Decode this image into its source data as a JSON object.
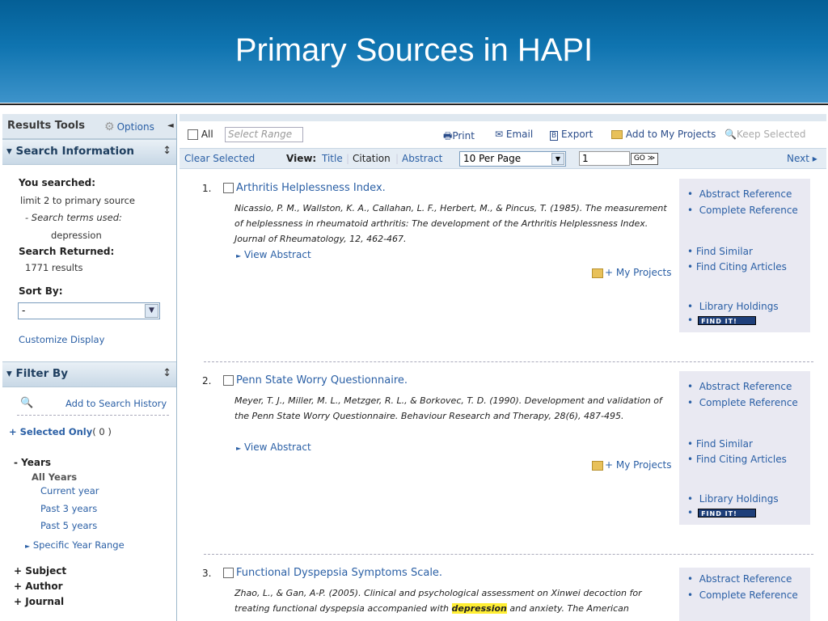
{
  "slide": {
    "title": "Primary Sources in HAPI"
  },
  "left": {
    "results_tools": "Results Tools",
    "options": "Options",
    "search_info_title": "Search Information",
    "you_searched_label": "You searched:",
    "you_searched_value": "limit 2 to primary source",
    "terms_label": "- Search terms used:",
    "terms_value": "depression",
    "returned_label": "Search Returned:",
    "returned_value": "1771 results",
    "sort_label": "Sort By:",
    "sort_value": "-",
    "customize": "Customize Display",
    "filter_title": "Filter By",
    "add_history": "Add to Search History",
    "selected_only": "Selected Only",
    "selected_count": "( 0 )",
    "years": "Years",
    "all_years": "All Years",
    "current_year": "Current year",
    "past3": "Past 3 years",
    "past5": "Past 5 years",
    "specific_range": "Specific Year Range",
    "subject": "Subject",
    "author": "Author",
    "journal": "Journal"
  },
  "toolbar": {
    "all": "All",
    "select_range_placeholder": "Select Range",
    "print": "Print",
    "email": "Email",
    "export": "Export",
    "add_projects": "Add to My Projects",
    "keep_selected": "Keep Selected",
    "clear_selected": "Clear Selected",
    "view_label": "View:",
    "view_title": "Title",
    "view_citation": "Citation",
    "view_abstract": "Abstract",
    "per_page": "10 Per Page",
    "page_value": "1",
    "go": "GO ≫",
    "next": "Next ▸"
  },
  "results": [
    {
      "num": "1.",
      "title": "Arthritis Helplessness Index.",
      "citation": "Nicassio, P. M., Wallston, K. A., Callahan, L. F., Herbert, M., & Pincus, T. (1985). The measurement of helplessness in rheumatoid arthritis: The development of the Arthritis Helplessness Index. Journal of Rheumatology, 12, 462-467.",
      "view_abstract": "View Abstract",
      "my_projects": "+ My Projects"
    },
    {
      "num": "2.",
      "title": "Penn State Worry Questionnaire.",
      "citation": "Meyer, T. J., Miller, M. L., Metzger, R. L., & Borkovec, T. D. (1990). Development and validation of the Penn State Worry Questionnaire. Behaviour Research and Therapy, 28(6), 487-495.",
      "view_abstract": "View Abstract",
      "my_projects": "+ My Projects"
    },
    {
      "num": "3.",
      "title": "Functional Dyspepsia Symptoms Scale.",
      "citation_pre": "Zhao, L., & Gan, A-P. (2005). Clinical and psychological assessment on Xinwei decoction for treating functional dyspepsia accompanied with ",
      "citation_hl": "depression",
      "citation_post": " and anxiety. The American"
    }
  ],
  "side_links": {
    "abstract_ref": "Abstract Reference",
    "complete_ref": "Complete Reference",
    "find_similar": "Find Similar",
    "find_citing": "Find Citing Articles",
    "library_holdings": "Library Holdings",
    "find_it": "FIND IT!"
  }
}
